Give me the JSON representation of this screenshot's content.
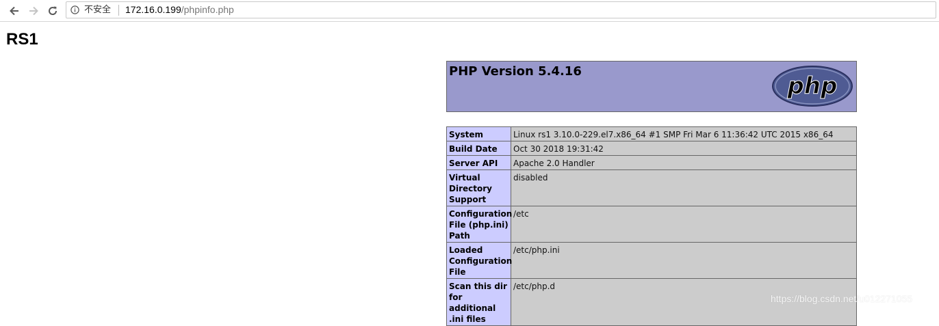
{
  "browser": {
    "security_label": "不安全",
    "url_host": "172.16.0.199",
    "url_path": "/phpinfo.php"
  },
  "page": {
    "heading": "RS1",
    "php_version": "PHP Version 5.4.16",
    "logo_text": "php"
  },
  "info_rows": [
    {
      "key": "System",
      "value": "Linux rs1 3.10.0-229.el7.x86_64 #1 SMP Fri Mar 6 11:36:42 UTC 2015 x86_64"
    },
    {
      "key": "Build Date",
      "value": "Oct 30 2018 19:31:42"
    },
    {
      "key": "Server API",
      "value": "Apache 2.0 Handler"
    },
    {
      "key": "Virtual Directory Support",
      "value": "disabled"
    },
    {
      "key": "Configuration File (php.ini) Path",
      "value": "/etc"
    },
    {
      "key": "Loaded Configuration File",
      "value": "/etc/php.ini"
    },
    {
      "key": "Scan this dir for additional .ini files",
      "value": "/etc/php.d"
    }
  ],
  "watermark": "https://blog.csdn.net/u012271055",
  "colors": {
    "header_bg": "#9999cc",
    "key_bg": "#ccccff",
    "value_bg": "#cccccc"
  }
}
